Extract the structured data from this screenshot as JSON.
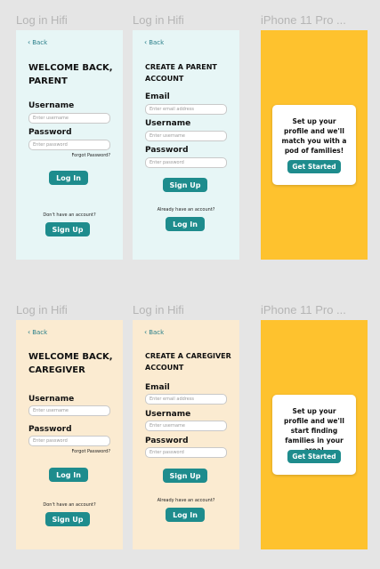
{
  "colors": {
    "canvas": "#e5e5e5",
    "parent_bg": "#e7f6f6",
    "caregiver_bg": "#fbebd1",
    "splash_bg": "#fec22e",
    "accent": "#1e8c8d"
  },
  "labels": {
    "login_hifi": "Log in Hifi",
    "iphone": "iPhone 11 Pro ..."
  },
  "common": {
    "back": "Back",
    "username": "Username",
    "password": "Password",
    "email": "Email",
    "username_ph": "Enter username",
    "password_ph": "Enter password",
    "email_ph": "Enter email address",
    "forgot": "Forgot Password?",
    "login_btn": "Log In",
    "signup_btn": "Sign Up",
    "no_account": "Don't have an account?",
    "have_account": "Already have an account?",
    "get_started": "Get Started"
  },
  "parent_login": {
    "heading": "WELCOME BACK, PARENT"
  },
  "parent_create": {
    "heading": "CREATE A PARENT ACCOUNT"
  },
  "parent_splash": {
    "text": "Set up your profile and we'll match you with a pod of families!"
  },
  "caregiver_login": {
    "heading": "WELCOME BACK, CAREGIVER"
  },
  "caregiver_create": {
    "heading": "CREATE A CAREGIVER ACCOUNT"
  },
  "caregiver_splash": {
    "text": "Set up your profile and we'll start finding families in your area!"
  }
}
